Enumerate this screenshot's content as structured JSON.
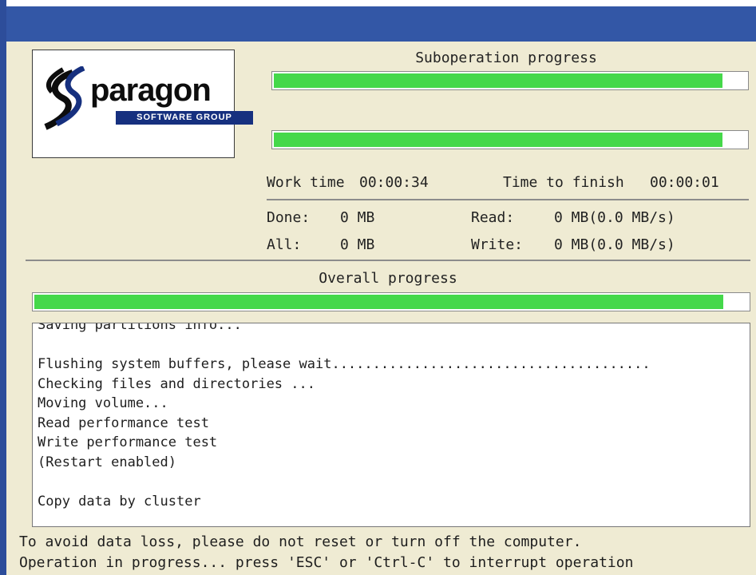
{
  "logo": {
    "word": "paragon",
    "sub": "SOFTWARE GROUP"
  },
  "suboperation": {
    "label": "Suboperation progress",
    "bar1_fraction": 0.95,
    "bar2_fraction": 0.95
  },
  "stats": {
    "work_time_label": "Work time",
    "work_time_value": "00:00:34",
    "time_to_finish_label": "Time to finish",
    "time_to_finish_value": "00:00:01",
    "done_label": "Done:",
    "done_value": "0 MB",
    "all_label": "All:",
    "all_value": "0 MB",
    "read_label": "Read:",
    "read_value": "0 MB(0.0 MB/s)",
    "write_label": "Write:",
    "write_value": "0 MB(0.0 MB/s)"
  },
  "overall": {
    "label": "Overall progress",
    "fraction": 0.965
  },
  "log": {
    "lines": [
      "Saving partitions info...",
      "",
      "Flushing system buffers, please wait.......................................",
      "Checking files and directories ...",
      "Moving volume...",
      "Read performance test",
      "Write performance test",
      "(Restart enabled)",
      "",
      "Copy data by cluster"
    ]
  },
  "footer": {
    "line1": "To avoid data loss, please do not reset or turn off the computer.",
    "line2": "Operation in progress... press 'ESC' or 'Ctrl-C' to interrupt operation"
  },
  "colors": {
    "titlebar": "#3357a6",
    "background": "#efebd3",
    "progress": "#45d84a",
    "logo_band": "#16307f"
  }
}
